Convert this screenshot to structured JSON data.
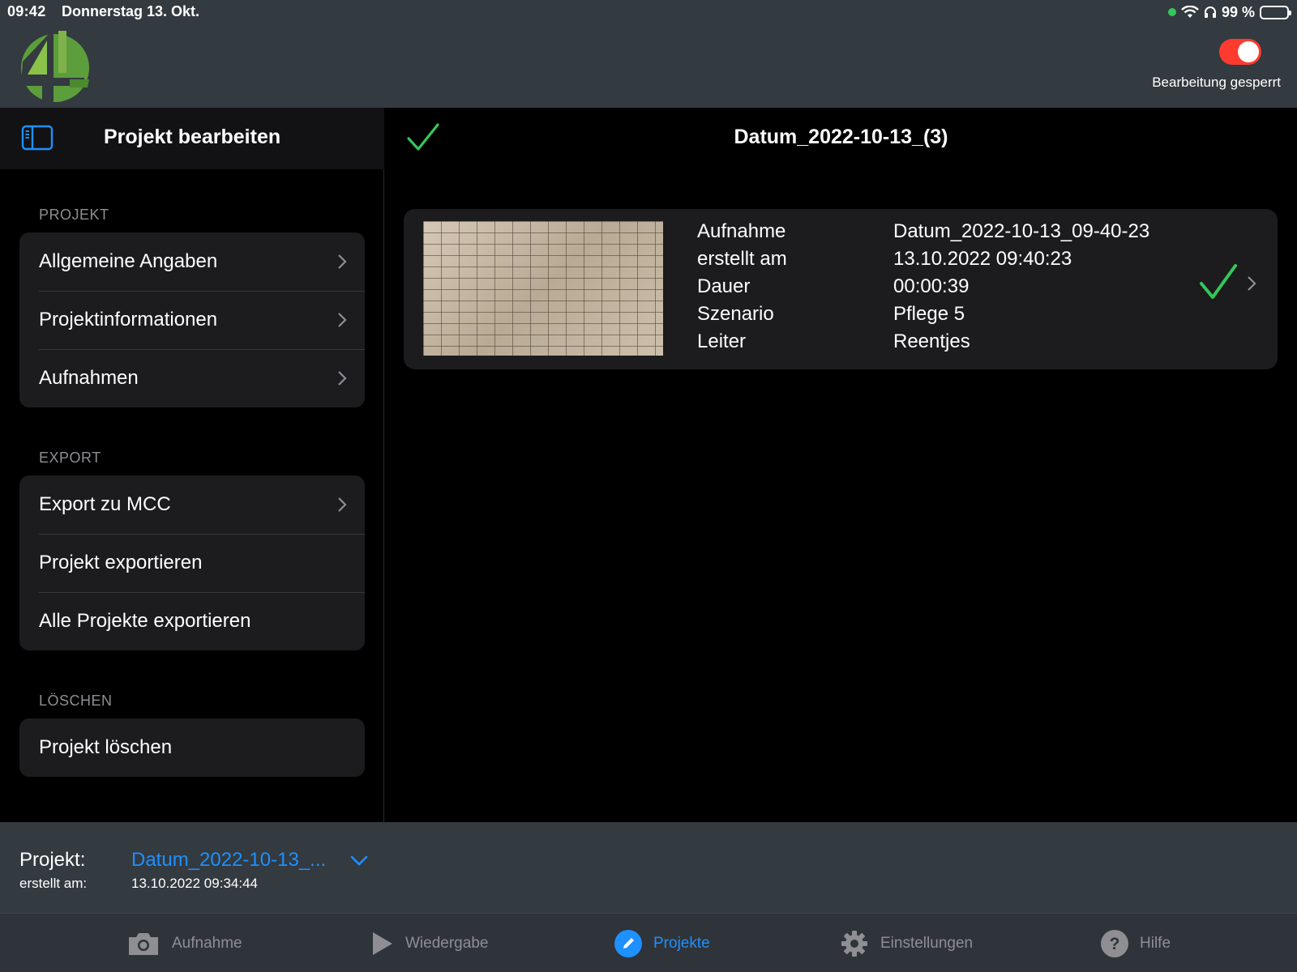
{
  "status_bar": {
    "time": "09:42",
    "date": "Donnerstag 13. Okt.",
    "battery": "99 %"
  },
  "header": {
    "logo_icon": "app-logo-4",
    "edit_lock_label": "Bearbeitung gesperrt",
    "edit_lock_on": true
  },
  "sidebar": {
    "title": "Projekt bearbeiten",
    "sections": [
      {
        "label": "PROJEKT",
        "items": [
          {
            "label": "Allgemeine Angaben",
            "chevron": true
          },
          {
            "label": "Projektinformationen",
            "chevron": true
          },
          {
            "label": "Aufnahmen",
            "chevron": true
          }
        ]
      },
      {
        "label": "EXPORT",
        "items": [
          {
            "label": "Export zu MCC",
            "chevron": true
          },
          {
            "label": "Projekt exportieren",
            "chevron": false
          },
          {
            "label": "Alle Projekte exportieren",
            "chevron": false
          }
        ]
      },
      {
        "label": "LÖSCHEN",
        "items": [
          {
            "label": "Projekt löschen",
            "chevron": false
          }
        ]
      }
    ]
  },
  "main": {
    "title": "Datum_2022-10-13_(3)",
    "recording": {
      "fields": [
        {
          "label": "Aufnahme",
          "value": "Datum_2022-10-13_09-40-23"
        },
        {
          "label": "erstellt am",
          "value": "13.10.2022 09:40:23"
        },
        {
          "label": "Dauer",
          "value": "00:00:39"
        },
        {
          "label": "Szenario",
          "value": "Pflege 5"
        },
        {
          "label": "Leiter",
          "value": "Reentjes"
        }
      ]
    }
  },
  "project_bar": {
    "label": "Projekt:",
    "name": "Datum_2022-10-13_...",
    "created_label": "erstellt am:",
    "created": "13.10.2022 09:34:44"
  },
  "tabs": [
    {
      "label": "Aufnahme",
      "icon": "camera-icon",
      "active": false
    },
    {
      "label": "Wiedergabe",
      "icon": "play-icon",
      "active": false
    },
    {
      "label": "Projekte",
      "icon": "pencil-icon",
      "active": true
    },
    {
      "label": "Einstellungen",
      "icon": "gear-icon",
      "active": false
    },
    {
      "label": "Hilfe",
      "icon": "help-icon",
      "active": false
    }
  ],
  "colors": {
    "accent": "#1e90ff",
    "check": "#34c759",
    "toggle_on": "#ff3b30",
    "bar": "#333a40"
  }
}
